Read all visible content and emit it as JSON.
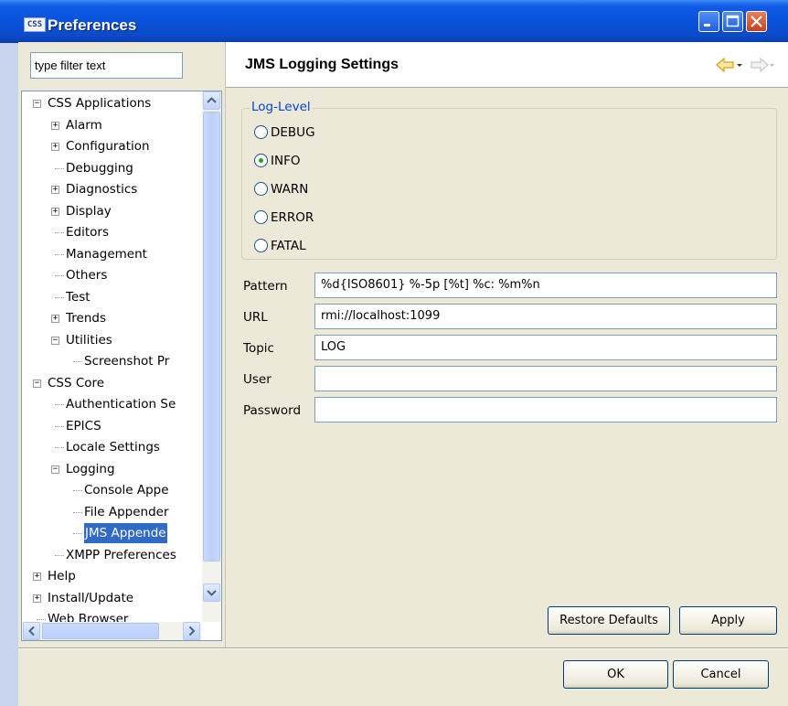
{
  "window": {
    "app_icon_text": "CSS",
    "title": "Preferences"
  },
  "left": {
    "filter_value": "type filter text",
    "tree": [
      {
        "label": "CSS Applications",
        "level": 0,
        "expander": "minus"
      },
      {
        "label": "Alarm",
        "level": 1,
        "expander": "plus"
      },
      {
        "label": "Configuration",
        "level": 1,
        "expander": "plus"
      },
      {
        "label": "Debugging",
        "level": 1,
        "expander": "none"
      },
      {
        "label": "Diagnostics",
        "level": 1,
        "expander": "plus"
      },
      {
        "label": "Display",
        "level": 1,
        "expander": "plus"
      },
      {
        "label": "Editors",
        "level": 1,
        "expander": "none"
      },
      {
        "label": "Management",
        "level": 1,
        "expander": "none"
      },
      {
        "label": "Others",
        "level": 1,
        "expander": "none"
      },
      {
        "label": "Test",
        "level": 1,
        "expander": "none"
      },
      {
        "label": "Trends",
        "level": 1,
        "expander": "plus"
      },
      {
        "label": "Utilities",
        "level": 1,
        "expander": "minus"
      },
      {
        "label": "Screenshot Pr",
        "level": 2,
        "expander": "none"
      },
      {
        "label": "CSS Core",
        "level": 0,
        "expander": "minus"
      },
      {
        "label": "Authentication Se",
        "level": 1,
        "expander": "none"
      },
      {
        "label": "EPICS",
        "level": 1,
        "expander": "none"
      },
      {
        "label": "Locale Settings",
        "level": 1,
        "expander": "none"
      },
      {
        "label": "Logging",
        "level": 1,
        "expander": "minus"
      },
      {
        "label": "Console Appe",
        "level": 2,
        "expander": "none"
      },
      {
        "label": "File Appender",
        "level": 2,
        "expander": "none"
      },
      {
        "label": "JMS Appende",
        "level": 2,
        "expander": "none",
        "selected": true
      },
      {
        "label": "XMPP Preferences",
        "level": 1,
        "expander": "none"
      },
      {
        "label": "Help",
        "level": 0,
        "expander": "plus"
      },
      {
        "label": "Install/Update",
        "level": 0,
        "expander": "plus"
      },
      {
        "label": "Web Browser",
        "level": 0,
        "expander": "none"
      }
    ]
  },
  "right": {
    "page_title": "JMS Logging Settings",
    "group_label": "Log-Level",
    "radios": [
      {
        "label": "DEBUG",
        "checked": false
      },
      {
        "label": "INFO",
        "checked": true
      },
      {
        "label": "WARN",
        "checked": false
      },
      {
        "label": "ERROR",
        "checked": false
      },
      {
        "label": "FATAL",
        "checked": false
      }
    ],
    "fields": [
      {
        "label": "Pattern",
        "value": "%d{ISO8601} %-5p [%t] %c: %m%n"
      },
      {
        "label": "URL",
        "value": "rmi://localhost:1099"
      },
      {
        "label": "Topic",
        "value": "LOG"
      },
      {
        "label": "User",
        "value": ""
      },
      {
        "label": "Password",
        "value": ""
      }
    ],
    "restore_defaults_label": "Restore Defaults",
    "apply_label": "Apply"
  },
  "footer": {
    "ok_label": "OK",
    "cancel_label": "Cancel"
  },
  "colors": {
    "title_bar": "#0a4fd8",
    "selection": "#316ac5",
    "group_label": "#0046d5",
    "radio_dot": "#21a121"
  }
}
